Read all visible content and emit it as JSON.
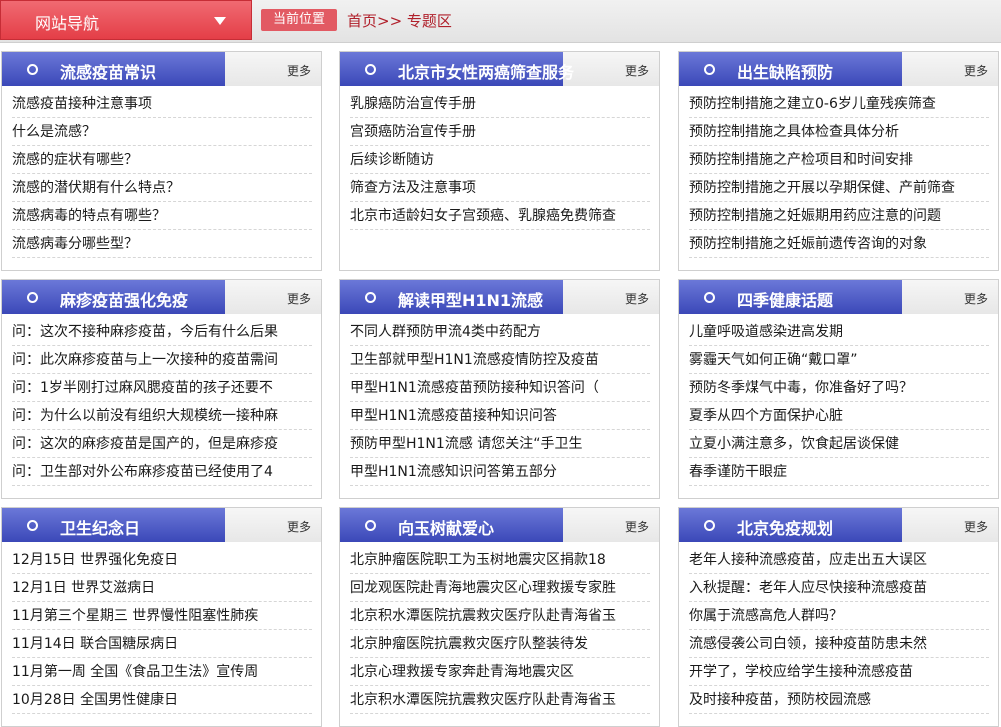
{
  "nav": {
    "menu_label": "网站导航",
    "location_label": "当前位置",
    "breadcrumb": "首页>> 专题区"
  },
  "more_label": "更多",
  "panels": [
    {
      "title": "流感疫苗常识",
      "items": [
        "流感疫苗接种注意事项",
        "什么是流感？",
        "流感的症状有哪些？",
        "流感的潜伏期有什么特点？",
        "流感病毒的特点有哪些？",
        "流感病毒分哪些型？"
      ]
    },
    {
      "title": "北京市女性两癌筛查服务",
      "items": [
        "乳腺癌防治宣传手册",
        "宫颈癌防治宣传手册",
        "后续诊断随访",
        "筛查方法及注意事项",
        "北京市适龄妇女子宫颈癌、乳腺癌免费筛查"
      ]
    },
    {
      "title": "出生缺陷预防",
      "items": [
        "预防控制措施之建立0-6岁儿童残疾筛查",
        "预防控制措施之具体检查具体分析",
        "预防控制措施之产检项目和时间安排",
        "预防控制措施之开展以孕期保健、产前筛查",
        "预防控制措施之妊娠期用药应注意的问题",
        "预防控制措施之妊娠前遗传咨询的对象"
      ]
    },
    {
      "title": "麻疹疫苗强化免疫",
      "items": [
        "问：这次不接种麻疹疫苗，今后有什么后果",
        "问：此次麻疹疫苗与上一次接种的疫苗需间",
        "问：1岁半刚打过麻风腮疫苗的孩子还要不",
        "问：为什么以前没有组织大规模统一接种麻",
        "问：这次的麻疹疫苗是国产的，但是麻疹疫",
        "问：卫生部对外公布麻疹疫苗已经使用了4"
      ]
    },
    {
      "title": "解读甲型H1N1流感",
      "items": [
        "不同人群预防甲流4类中药配方",
        "卫生部就甲型H1N1流感疫情防控及疫苗",
        "甲型H1N1流感疫苗预防接种知识答问（",
        "甲型H1N1流感疫苗接种知识问答",
        "预防甲型H1N1流感 请您关注“手卫生",
        "甲型H1N1流感知识问答第五部分"
      ]
    },
    {
      "title": "四季健康话题",
      "items": [
        "儿童呼吸道感染进高发期",
        "雾霾天气如何正确“戴口罩”",
        "预防冬季煤气中毒，你准备好了吗？",
        "夏季从四个方面保护心脏",
        "立夏小满注意多，饮食起居谈保健",
        "春季谨防干眼症"
      ]
    },
    {
      "title": "卫生纪念日",
      "items": [
        "12月15日 世界强化免疫日",
        "12月1日 世界艾滋病日",
        "11月第三个星期三 世界慢性阻塞性肺疾",
        "11月14日 联合国糖尿病日",
        "11月第一周 全国《食品卫生法》宣传周",
        "10月28日 全国男性健康日"
      ]
    },
    {
      "title": "向玉树献爱心",
      "items": [
        "北京肿瘤医院职工为玉树地震灾区捐款18",
        "回龙观医院赴青海地震灾区心理救援专家胜",
        "北京积水潭医院抗震救灾医疗队赴青海省玉",
        "北京肿瘤医院抗震救灾医疗队整装待发",
        "北京心理救援专家奔赴青海地震灾区",
        "北京积水潭医院抗震救灾医疗队赴青海省玉"
      ]
    },
    {
      "title": "北京免疫规划",
      "items": [
        "老年人接种流感疫苗，应走出五大误区",
        "入秋提醒：老年人应尽快接种流感疫苗",
        "你属于流感高危人群吗？",
        "流感侵袭公司白领，接种疫苗防患未然",
        "开学了，学校应给学生接种流感疫苗",
        "及时接种疫苗，预防校园流感"
      ]
    }
  ]
}
